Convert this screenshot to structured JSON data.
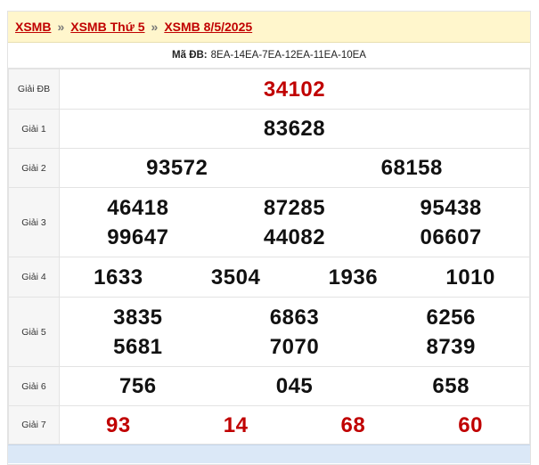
{
  "breadcrumb": [
    "XSMB",
    "XSMB Thứ 5",
    "XSMB 8/5/2025"
  ],
  "separator": "»",
  "code": {
    "label": "Mã ĐB:",
    "value": "8EA-14EA-7EA-12EA-11EA-10EA"
  },
  "prizes": [
    {
      "label": "Giải ĐB",
      "numbers": [
        "34102"
      ]
    },
    {
      "label": "Giải 1",
      "numbers": [
        "83628"
      ]
    },
    {
      "label": "Giải 2",
      "numbers": [
        "93572",
        "68158"
      ]
    },
    {
      "label": "Giải 3",
      "numbers": [
        "46418",
        "87285",
        "95438",
        "99647",
        "44082",
        "06607"
      ]
    },
    {
      "label": "Giải 4",
      "numbers": [
        "1633",
        "3504",
        "1936",
        "1010"
      ]
    },
    {
      "label": "Giải 5",
      "numbers": [
        "3835",
        "6863",
        "6256",
        "5681",
        "7070",
        "8739"
      ]
    },
    {
      "label": "Giải 6",
      "numbers": [
        "756",
        "045",
        "658"
      ]
    },
    {
      "label": "Giải 7",
      "numbers": [
        "93",
        "14",
        "68",
        "60"
      ]
    }
  ],
  "colors": {
    "accent": "#c00000",
    "breadcrumb_bg": "#fff6cc",
    "label_bg": "#f6f6f6"
  }
}
